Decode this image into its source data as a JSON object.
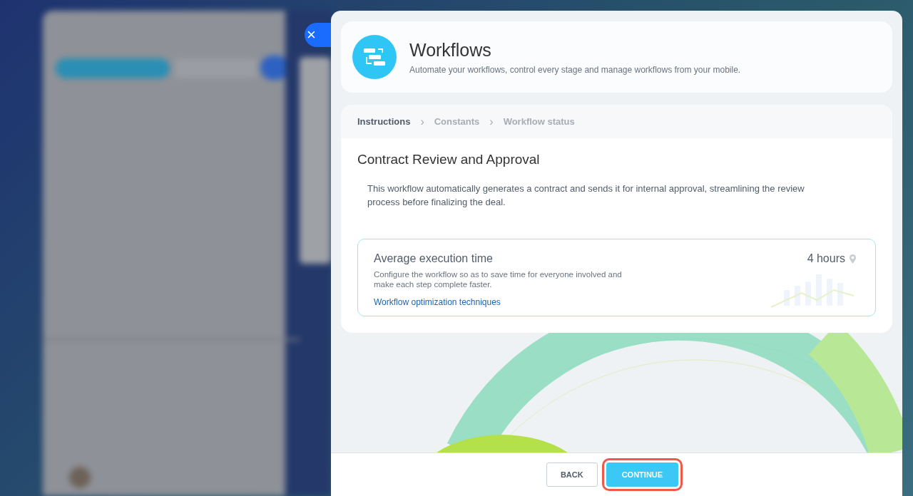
{
  "header": {
    "title": "Workflows",
    "subtitle": "Automate your workflows, control every stage and manage workflows from your mobile."
  },
  "steps": [
    {
      "label": "Instructions",
      "selected": true
    },
    {
      "label": "Constants",
      "selected": false
    },
    {
      "label": "Workflow status",
      "selected": false
    }
  ],
  "separator": "›",
  "content": {
    "title": "Contract Review and Approval",
    "description": "This workflow automatically generates a contract and sends it for internal approval, streamlining the review process before finalizing the deal."
  },
  "stat_card": {
    "title": "Average execution time",
    "text": "Configure the workflow so as to save time for everyone involved and make each step complete faster.",
    "link": "Workflow optimization techniques",
    "value": "4 hours"
  },
  "close": "×",
  "buttons": [
    {
      "label": "BACK",
      "kind": "secondary",
      "highlighted": false
    },
    {
      "label": "CONTINUE",
      "kind": "primary",
      "highlighted": true
    }
  ]
}
